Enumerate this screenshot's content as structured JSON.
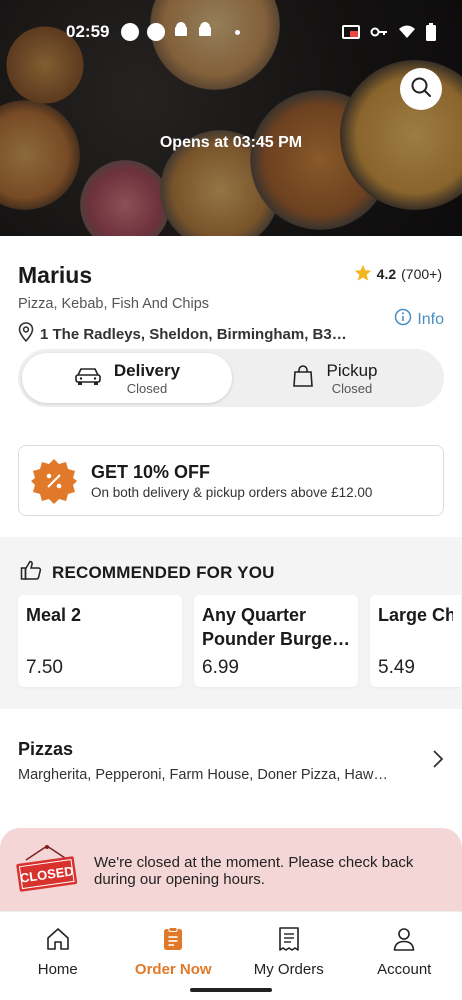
{
  "status_bar": {
    "time": "02:59"
  },
  "hero": {
    "opens_text": "Opens at 03:45 PM"
  },
  "restaurant": {
    "name": "Marius",
    "rating": "4.2",
    "rating_count": "(700+)",
    "cuisine": "Pizza, Kebab, Fish And Chips",
    "address": "1 The Radleys, Sheldon, Birmingham, B3…",
    "info_label": "Info"
  },
  "order_mode": {
    "delivery": {
      "label": "Delivery",
      "status": "Closed"
    },
    "pickup": {
      "label": "Pickup",
      "status": "Closed"
    }
  },
  "offer": {
    "title": "GET 10% OFF",
    "subtitle": "On both delivery & pickup orders above £12.00"
  },
  "recommended": {
    "heading": "RECOMMENDED FOR YOU",
    "items": [
      {
        "name": "Meal 2",
        "price": "7.50"
      },
      {
        "name": "Any Quarter Pounder Burge…",
        "price": "6.99"
      },
      {
        "name": "Large Chi",
        "price": "5.49"
      }
    ]
  },
  "category": {
    "title": "Pizzas",
    "items": "Margherita, Pepperoni, Farm House, Doner Pizza, Haw…"
  },
  "closed_banner": {
    "sign_text": "CLOSED",
    "message": "We're closed at the moment. Please check back during our opening hours."
  },
  "nav": {
    "home": "Home",
    "order_now": "Order Now",
    "my_orders": "My Orders",
    "account": "Account"
  },
  "colors": {
    "accent": "#e07a2a",
    "info_blue": "#4a8fc4",
    "closed_bg": "#f5d6d6",
    "star": "#f2b51e"
  }
}
